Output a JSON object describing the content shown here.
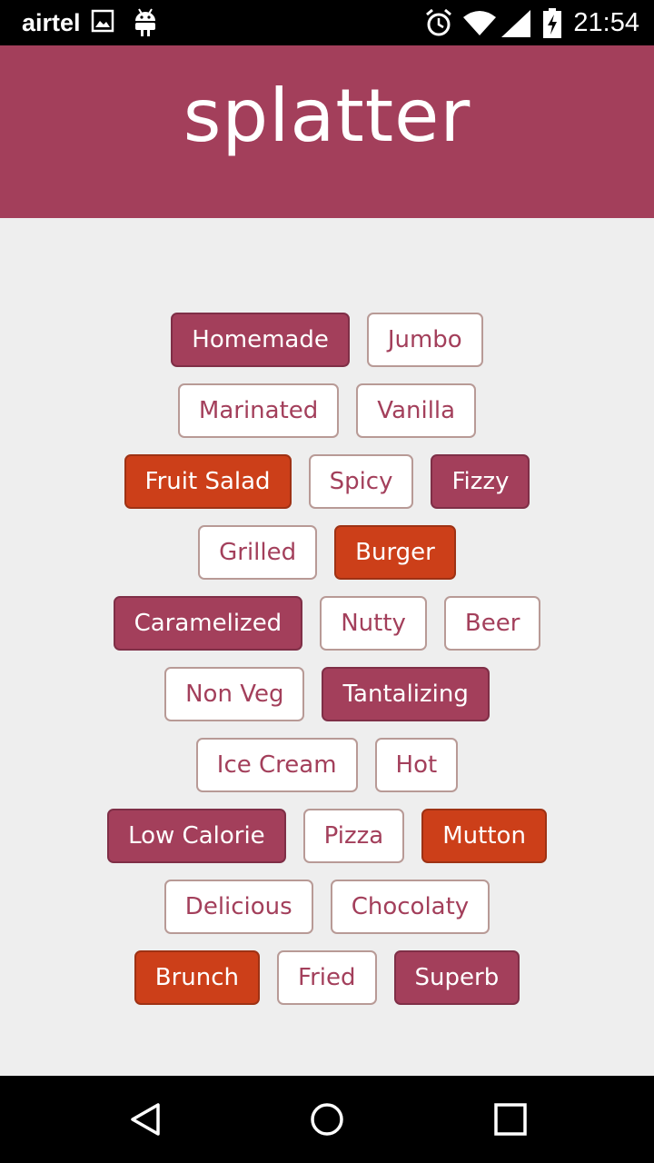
{
  "status_bar": {
    "carrier": "airtel",
    "time": "21:54",
    "icons": [
      "image-icon",
      "android-icon",
      "alarm-icon",
      "wifi-icon",
      "signal-icon",
      "battery-charging-icon"
    ]
  },
  "app_bar": {
    "title": "splatter",
    "color": "#a33f5b"
  },
  "tag_colors": {
    "outline_text": "#a33f5b",
    "berry": "#a33f5b",
    "orange": "#cc3f19"
  },
  "tags": {
    "rows": [
      [
        {
          "label": "Homemade",
          "style": "berry"
        },
        {
          "label": "Jumbo",
          "style": "outline"
        }
      ],
      [
        {
          "label": "Marinated",
          "style": "outline"
        },
        {
          "label": "Vanilla",
          "style": "outline"
        }
      ],
      [
        {
          "label": "Fruit Salad",
          "style": "orange"
        },
        {
          "label": "Spicy",
          "style": "outline"
        },
        {
          "label": "Fizzy",
          "style": "berry"
        }
      ],
      [
        {
          "label": "Grilled",
          "style": "outline"
        },
        {
          "label": "Burger",
          "style": "orange"
        }
      ],
      [
        {
          "label": "Caramelized",
          "style": "berry"
        },
        {
          "label": "Nutty",
          "style": "outline"
        },
        {
          "label": "Beer",
          "style": "outline"
        }
      ],
      [
        {
          "label": "Non Veg",
          "style": "outline"
        },
        {
          "label": "Tantalizing",
          "style": "berry"
        }
      ],
      [
        {
          "label": "Ice Cream",
          "style": "outline"
        },
        {
          "label": "Hot",
          "style": "outline"
        }
      ],
      [
        {
          "label": "Low Calorie",
          "style": "berry"
        },
        {
          "label": "Pizza",
          "style": "outline"
        },
        {
          "label": "Mutton",
          "style": "orange"
        }
      ],
      [
        {
          "label": "Delicious",
          "style": "outline"
        },
        {
          "label": "Chocolaty",
          "style": "outline"
        }
      ],
      [
        {
          "label": "Brunch",
          "style": "orange"
        },
        {
          "label": "Fried",
          "style": "outline"
        },
        {
          "label": "Superb",
          "style": "berry"
        }
      ]
    ]
  },
  "nav_bar": {
    "icons": [
      "back-icon",
      "home-icon",
      "recents-icon"
    ]
  }
}
